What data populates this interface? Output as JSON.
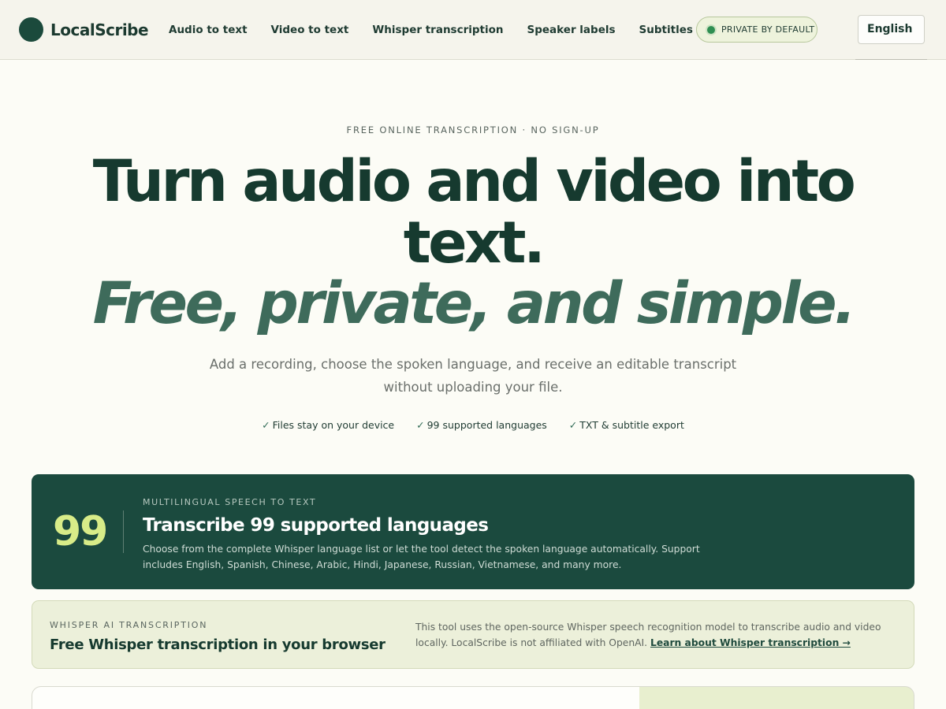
{
  "brand": {
    "name": "LocalScribe"
  },
  "nav": {
    "items": [
      {
        "label": "Audio to text"
      },
      {
        "label": "Video to text"
      },
      {
        "label": "Whisper transcription"
      },
      {
        "label": "Speaker labels"
      },
      {
        "label": "Subtitles"
      }
    ]
  },
  "badge": {
    "label": "PRIVATE BY DEFAULT"
  },
  "language": {
    "selected": "English"
  },
  "hero": {
    "eyebrow": "FREE ONLINE TRANSCRIPTION · NO SIGN-UP",
    "title_line1": "Turn audio and video into",
    "title_line2": "text.",
    "title_accent": "Free, private, and simple.",
    "subtitle_line1": "Add a recording, choose the spoken language, and receive an editable transcript",
    "subtitle_line2": "without uploading your file.",
    "checks": [
      {
        "mark": "✓",
        "label": "Files stay on your device"
      },
      {
        "mark": "✓",
        "label": "99 supported languages"
      },
      {
        "mark": "✓",
        "label": "TXT & subtitle export"
      }
    ]
  },
  "languages_card": {
    "count": "99",
    "eyebrow": "MULTILINGUAL SPEECH TO TEXT",
    "title": "Transcribe 99 supported languages",
    "description": "Choose from the complete Whisper language list or let the tool detect the spoken language automatically. Support includes English, Spanish, Chinese, Arabic, Hindi, Japanese, Russian, Vietnamese, and many more."
  },
  "whisper_card": {
    "eyebrow": "WHISPER AI TRANSCRIPTION",
    "title": "Free Whisper transcription in your browser",
    "description": "This tool uses the open-source Whisper speech recognition model to transcribe audio and video locally. LocalScribe is not affiliated with OpenAI. ",
    "link_label": "Learn about Whisper transcription →"
  },
  "colors": {
    "brand_dark": "#1b4a3e",
    "accent_lime": "#d8ec88",
    "accent_green": "#3e6b5b",
    "badge_dot": "#2f8f52"
  }
}
